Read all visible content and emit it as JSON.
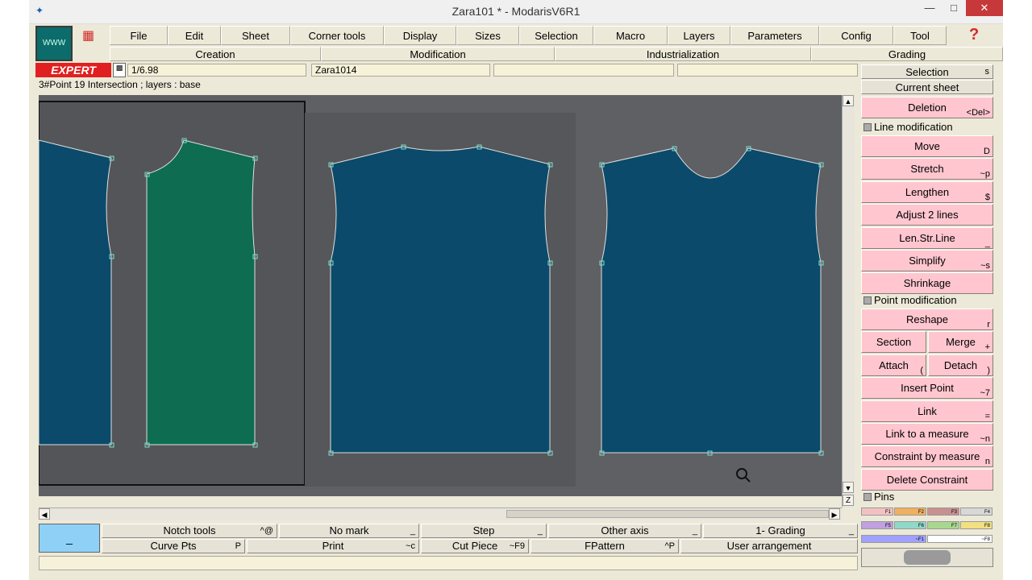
{
  "window": {
    "title": "Zara101 * - ModarisV6R1",
    "tile_text": "WWW"
  },
  "menu": [
    {
      "id": "file",
      "label": "File",
      "w": 72
    },
    {
      "id": "edit",
      "label": "Edit",
      "w": 66
    },
    {
      "id": "sheet",
      "label": "Sheet",
      "w": 86
    },
    {
      "id": "corner-tools",
      "label": "Corner tools",
      "w": 116
    },
    {
      "id": "display",
      "label": "Display",
      "w": 90
    },
    {
      "id": "sizes",
      "label": "Sizes",
      "w": 78
    },
    {
      "id": "selection",
      "label": "Selection",
      "w": 92
    },
    {
      "id": "macro",
      "label": "Macro",
      "w": 92
    },
    {
      "id": "layers",
      "label": "Layers",
      "w": 78
    },
    {
      "id": "parameters",
      "label": "Parameters",
      "w": 110
    },
    {
      "id": "config",
      "label": "Config",
      "w": 92
    },
    {
      "id": "tool",
      "label": "Tool",
      "w": 66
    }
  ],
  "categories": [
    {
      "label": "Creation",
      "w": 262
    },
    {
      "label": "Modification",
      "w": 290
    },
    {
      "label": "Industrialization",
      "w": 318
    },
    {
      "label": "Grading",
      "w": 238
    }
  ],
  "mode": {
    "badge": "EXPERT",
    "scale": "1/6.98",
    "piece_name": "Zara1014"
  },
  "status_message": "3#Point 19 Intersection ;    layers :  base",
  "right_panel": {
    "selection": {
      "label": "Selection",
      "shortcut": "s"
    },
    "current_sheet": "Current sheet",
    "deletion": {
      "label": "Deletion",
      "shortcut": "<Del>"
    },
    "line_modification": "Line modification",
    "move": {
      "label": "Move",
      "shortcut": "D"
    },
    "stretch": {
      "label": "Stretch",
      "shortcut": "~p"
    },
    "lengthen": {
      "label": "Lengthen",
      "shortcut": "$"
    },
    "adjust_2_lines": {
      "label": "Adjust 2 lines",
      "shortcut": ""
    },
    "len_str_line": {
      "label": "Len.Str.Line",
      "shortcut": "_"
    },
    "simplify": {
      "label": "Simplify",
      "shortcut": "~s"
    },
    "shrinkage": {
      "label": "Shrinkage",
      "shortcut": ""
    },
    "point_modification": "Point modification",
    "reshape": {
      "label": "Reshape",
      "shortcut": "r"
    },
    "section": {
      "label": "Section",
      "shortcut": ""
    },
    "merge": {
      "label": "Merge",
      "shortcut": "+"
    },
    "attach": {
      "label": "Attach",
      "shortcut": "("
    },
    "detach": {
      "label": "Detach",
      "shortcut": ")"
    },
    "insert_point": {
      "label": "Insert Point",
      "shortcut": "~7"
    },
    "link": {
      "label": "Link",
      "shortcut": "="
    },
    "link_to_measure": {
      "label": "Link to a measure",
      "shortcut": "~n"
    },
    "constraint_by_measure": {
      "label": "Constraint by measure",
      "shortcut": "n"
    },
    "delete_constraint": {
      "label": "Delete Constraint",
      "shortcut": ""
    },
    "pins": "Pins",
    "fkeys": [
      {
        "label": "F1",
        "color": "#f3c1c1"
      },
      {
        "label": "F2",
        "color": "#f0b060"
      },
      {
        "label": "F3",
        "color": "#c89090"
      },
      {
        "label": "F4",
        "color": "#d8d8d8"
      },
      {
        "label": "F5",
        "color": "#c0a0e0"
      },
      {
        "label": "F6",
        "color": "#90d8c8"
      },
      {
        "label": "F7",
        "color": "#a8d890"
      },
      {
        "label": "F8",
        "color": "#f0e080"
      },
      {
        "label": "~F1",
        "color": "#a0a0ff"
      },
      {
        "label": "~F8",
        "color": "#ffffff"
      }
    ]
  },
  "bottom_toolbar": {
    "blue_button": "_",
    "row1": [
      {
        "label": "Notch tools",
        "shortcut": "^@"
      },
      {
        "label": "No mark",
        "shortcut": "_"
      },
      {
        "label": "Step",
        "shortcut": "_"
      },
      {
        "label": "Other axis",
        "shortcut": "_"
      },
      {
        "label": "1- Grading",
        "shortcut": "_"
      }
    ],
    "row2": [
      {
        "label": "Curve Pts",
        "shortcut": "P"
      },
      {
        "label": "Print",
        "shortcut": "~c"
      },
      {
        "label": "Cut Piece",
        "shortcut": "~F9"
      },
      {
        "label": "FPattern",
        "shortcut": "^P"
      },
      {
        "label": "User arrangement",
        "shortcut": ""
      }
    ]
  },
  "colors": {
    "piece_blue": "#0b4a6a",
    "piece_green": "#0e6c50",
    "canvas_bg": "#5e6064",
    "pink": "#ffc6cf"
  }
}
